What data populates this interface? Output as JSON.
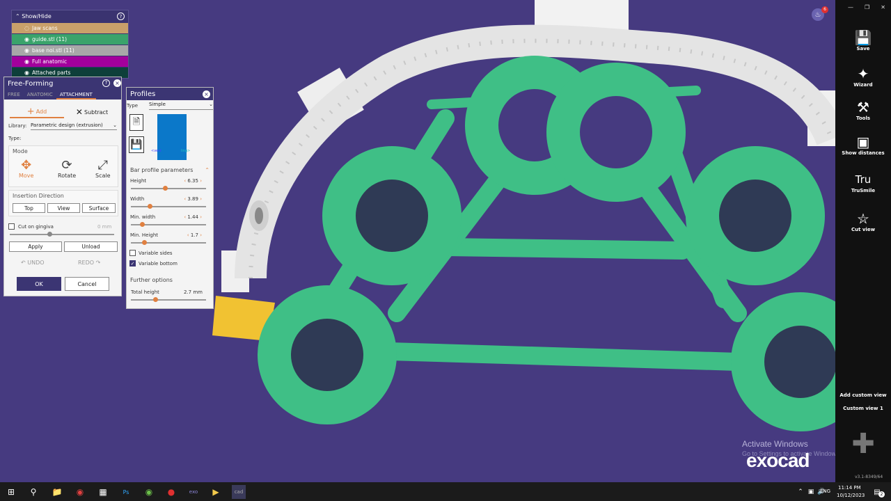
{
  "showhide": {
    "title": "Show/Hide",
    "items": [
      {
        "label": "Jaw scans",
        "color": "#c9a06a"
      },
      {
        "label": "guide.stl (11)",
        "color": "#3aa36b"
      },
      {
        "label": "base noi.stl (11)",
        "color": "#a8a8a8"
      },
      {
        "label": "Full anatomic",
        "color": "#a3009c"
      },
      {
        "label": "Attached parts",
        "color": "#0e3f3a"
      }
    ]
  },
  "freeforming": {
    "title": "Free-Forming",
    "tabs": [
      "FREE",
      "ANATOMIC",
      "ATTACHMENT"
    ],
    "add_label": "Add",
    "subtract_label": "Subtract",
    "library_label": "Library:",
    "library_value": "Parametric design (extrusion)",
    "type_label": "Type:",
    "mode_title": "Mode",
    "modes": [
      "Move",
      "Rotate",
      "Scale"
    ],
    "insertion_title": "Insertion Direction",
    "insertion_buttons": [
      "Top",
      "View",
      "Surface"
    ],
    "cut_label": "Cut on gingiva",
    "cut_value": "0 mm",
    "apply": "Apply",
    "unload": "Unload",
    "undo": "UNDO",
    "redo": "REDO",
    "ok": "OK",
    "cancel": "Cancel"
  },
  "profiles": {
    "title": "Profiles",
    "type_label": "Type",
    "type_value": "Simple",
    "vest": "<vest",
    "ling": "ling>",
    "section_title": "Bar profile parameters",
    "params": [
      {
        "label": "Height",
        "value": "6.35",
        "fraction": 0.45
      },
      {
        "label": "Width",
        "value": "3.89",
        "fraction": 0.25
      },
      {
        "label": "Min. width",
        "value": "1.44",
        "fraction": 0.15
      },
      {
        "label": "Min. Height",
        "value": "1.7",
        "fraction": 0.18
      }
    ],
    "variable_sides": "Variable sides",
    "variable_bottom": "Variable bottom",
    "further_title": "Further options",
    "total_height_label": "Total height",
    "total_height_value": "2.7 mm",
    "total_height_fraction": 0.32
  },
  "sidebar": {
    "items": [
      {
        "label": "Save",
        "icon": "save-icon"
      },
      {
        "label": "Wizard",
        "icon": "wizard-icon"
      },
      {
        "label": "Tools",
        "icon": "tools-icon"
      },
      {
        "label": "Show distances",
        "icon": "distances-icon"
      },
      {
        "label": "TruSmile",
        "icon": "trusmile-icon"
      },
      {
        "label": "Cut view",
        "icon": "cutview-icon"
      }
    ],
    "add_custom_view": "Add custom view",
    "custom_view_1": "Custom view 1",
    "version": "v3.1-8349/64"
  },
  "notification_count": "6",
  "watermark": {
    "activate_title": "Activate Windows",
    "activate_sub": "Go to Settings to activate Windows.",
    "brand": "exocad"
  },
  "taskbar": {
    "lang": "ENG",
    "time": "11:14 PM",
    "date": "10/12/2023",
    "notif": "2"
  },
  "colors": {
    "background": "#463a80",
    "green": "#3fbf86",
    "accent": "#e08040",
    "panel_header": "#3b3573"
  }
}
